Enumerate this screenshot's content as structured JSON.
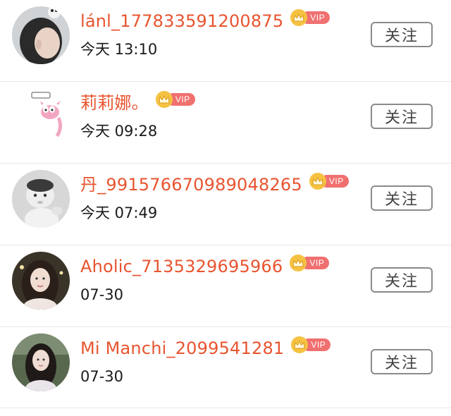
{
  "colors": {
    "username": "#e8542f",
    "vip_crown": "#f5c242",
    "vip_label_bg": "#f07070",
    "button_border": "#8a8a8a",
    "divider": "#e6e6e6"
  },
  "users": [
    {
      "name": "lánl_177833591200875",
      "vip_label": "VIP",
      "time": "今天 13:10",
      "follow_label": "关注",
      "avatar_icon": "girl-with-hair-clip-avatar"
    },
    {
      "name": "莉莉娜。",
      "vip_label": "VIP",
      "time": "今天 09:28",
      "follow_label": "关注",
      "avatar_icon": "pink-panther-avatar"
    },
    {
      "name": "丹_991576670989048265",
      "vip_label": "VIP",
      "time": "今天 07:49",
      "follow_label": "关注",
      "avatar_icon": "baby-photo-avatar"
    },
    {
      "name": "Aholic_7135329695966",
      "vip_label": "VIP",
      "time": "07-30",
      "follow_label": "关注",
      "avatar_icon": "girl-portrait-avatar"
    },
    {
      "name": "Mi Manchi_2099541281",
      "vip_label": "VIP",
      "time": "07-30",
      "follow_label": "关注",
      "avatar_icon": "girl-outdoor-avatar"
    }
  ]
}
